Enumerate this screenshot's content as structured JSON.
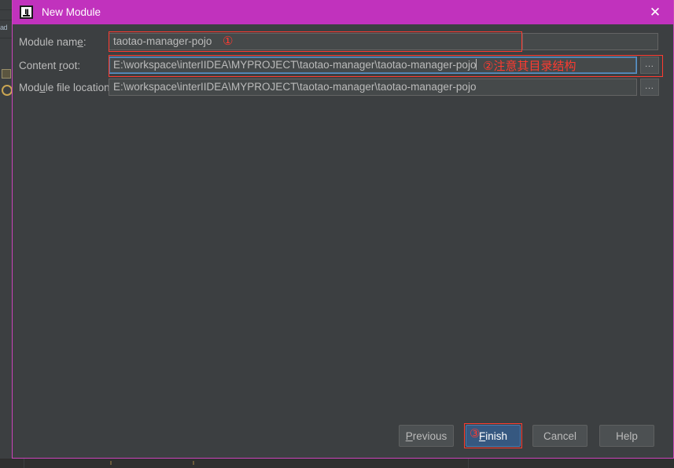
{
  "window": {
    "title": "New Module",
    "app_icon": "intellij-idea-icon",
    "close_icon": "close-icon",
    "titlebar_color": "#c132bd",
    "body_color": "#3c3f41",
    "border_color": "#cc44bb"
  },
  "form": {
    "rows": [
      {
        "id": "module-name",
        "label_before": "Module nam",
        "label_mnemonic": "e",
        "label_after": ":",
        "value": "taotao-manager-pojo",
        "placeholder": "",
        "focused": false,
        "has_browse": false,
        "browse_label": "…"
      },
      {
        "id": "content-root",
        "label_before": "Content ",
        "label_mnemonic": "r",
        "label_after": "oot:",
        "value": "E:\\workspace\\interIIDEA\\MYPROJECT\\taotao-manager\\taotao-manager-pojo",
        "placeholder": "",
        "focused": true,
        "has_browse": true,
        "browse_label": "…"
      },
      {
        "id": "module-file-location",
        "label_before": "Mod",
        "label_mnemonic": "u",
        "label_after": "le file location:",
        "value": "E:\\workspace\\interIIDEA\\MYPROJECT\\taotao-manager\\taotao-manager-pojo",
        "placeholder": "",
        "focused": false,
        "has_browse": true,
        "browse_label": "…"
      }
    ]
  },
  "annotations": {
    "color": "#ff3b30",
    "marker_one": "①",
    "marker_two": "②注意其目录结构",
    "marker_three": "③"
  },
  "buttons": [
    {
      "id": "previous",
      "before": "",
      "mnemonic": "P",
      "after": "revious",
      "default": false
    },
    {
      "id": "finish",
      "before": "",
      "mnemonic": "F",
      "after": "inish",
      "default": true
    },
    {
      "id": "cancel",
      "before": "Cancel",
      "mnemonic": "",
      "after": "",
      "default": false
    },
    {
      "id": "help",
      "before": "Help",
      "mnemonic": "",
      "after": "",
      "default": false
    }
  ],
  "backdrop": {
    "strip_text": "ad",
    "icons": [
      "module-folder-icon",
      "orange-dot-icon"
    ]
  }
}
